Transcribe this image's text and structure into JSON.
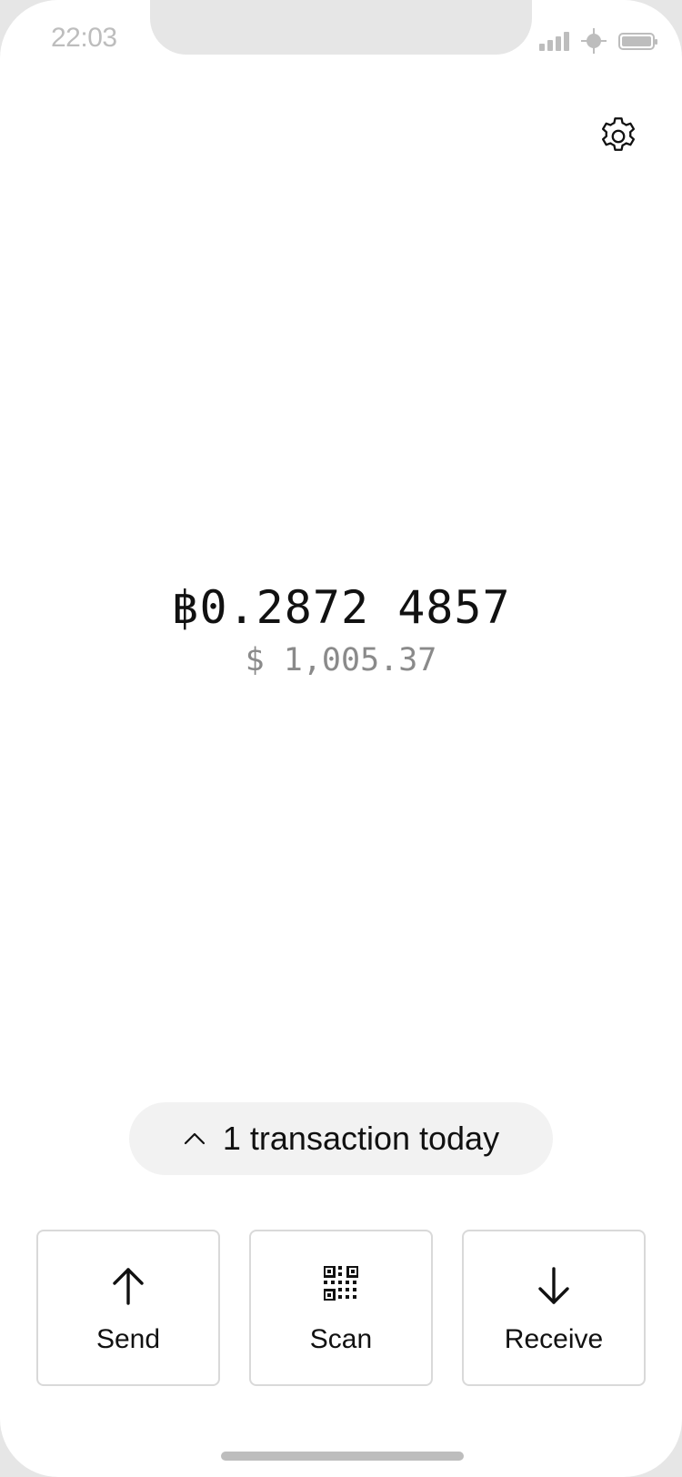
{
  "status_bar": {
    "time": "22:03",
    "icons": [
      "cellular-signal-icon",
      "connectivity-icon",
      "battery-icon"
    ]
  },
  "header": {
    "settings_icon": "gear-icon"
  },
  "balance": {
    "btc": "฿0.2872 4857",
    "usd": "$ 1,005.37"
  },
  "transactions": {
    "label": "1 transaction today",
    "icon": "chevron-up-icon"
  },
  "actions": [
    {
      "label": "Send",
      "icon": "arrow-up-icon"
    },
    {
      "label": "Scan",
      "icon": "qr-code-icon"
    },
    {
      "label": "Receive",
      "icon": "arrow-down-icon"
    }
  ]
}
